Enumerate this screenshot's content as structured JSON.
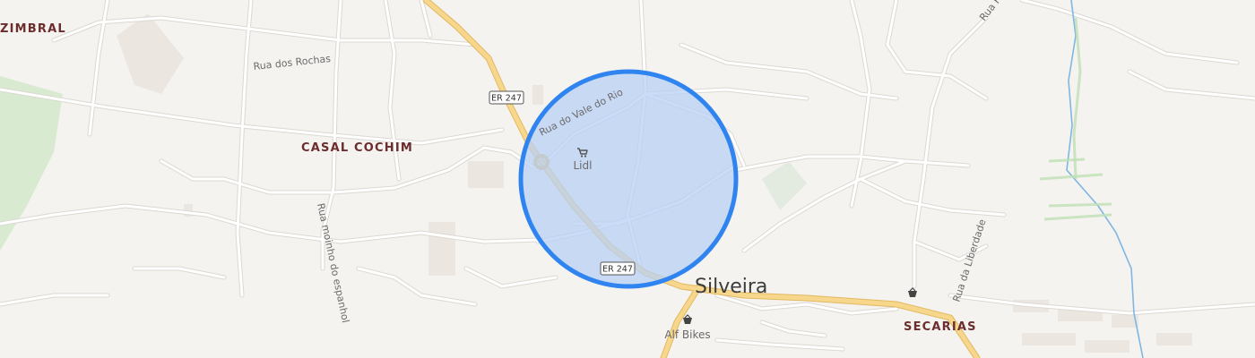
{
  "map": {
    "places": {
      "zimbral": "ZIMBRAL",
      "casal_cochim": "CASAL COCHIM",
      "silveira": "Silveira",
      "secarias": "SECARIAS"
    },
    "streets": {
      "rua_dos_rochas": "Rua dos Rochas",
      "rua_do_vale_do_rio": "Rua do Vale do Rio",
      "rua_moinho_do_espanhol": "Rua moinho do espanhol",
      "rua_da_liberdade": "Rua da Liberdade",
      "rua_top_right": "Rua F"
    },
    "road_shields": {
      "er247_north": "ER 247",
      "er247_south": "ER 247"
    },
    "pois": {
      "lidl": "Lidl",
      "alf_bikes": "Alf Bikes"
    },
    "colors": {
      "background": "#f5f3f0",
      "road_minor": "#ffffff",
      "road_minor_casing": "#dcd8d2",
      "road_major": "#f7d78b",
      "road_major_casing": "#e2b862",
      "park": "#d8ead0",
      "building": "#e9e2dc",
      "water": "#7fb6e3",
      "accuracy_circle_fill": "#b8d0f5",
      "accuracy_circle_stroke": "#2f84f0",
      "place_label": "#6b2d2d"
    },
    "icons": [
      "shopping-cart-icon",
      "shopping-basket-icon",
      "road-shield-icon"
    ],
    "accuracy_circle": {
      "shown": true
    }
  }
}
